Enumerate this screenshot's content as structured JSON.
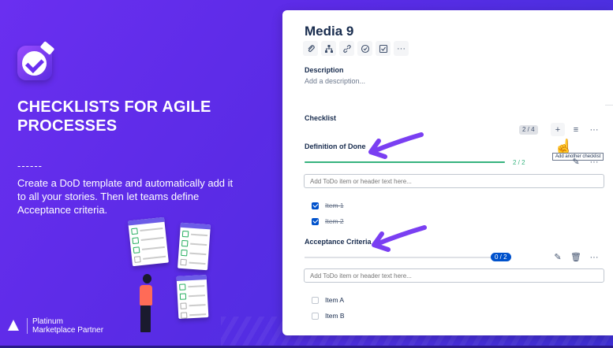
{
  "marketing": {
    "headline": "CHECKLISTS FOR AGILE PROCESSES",
    "dashes": "------",
    "blurb": "Create a DoD template and automatically add it to all your stories. Then let teams define Acceptance criteria.",
    "partner_line1": "Platinum",
    "partner_line2": "Marketplace Partner",
    "partner_logo_text": "ATLASSIAN"
  },
  "issue": {
    "title": "Media 9",
    "toolbar": [
      {
        "icon": "paperclip-icon"
      },
      {
        "icon": "hierarchy-icon"
      },
      {
        "icon": "link-icon"
      },
      {
        "icon": "clock-icon"
      },
      {
        "icon": "checklist-icon"
      },
      {
        "icon": "more-icon",
        "glyph": "···"
      }
    ],
    "description_label": "Description",
    "description_placeholder": "Add a description..."
  },
  "checklist": {
    "label": "Checklist",
    "count": "2 / 4",
    "add_glyph": "+",
    "filter_glyph": "≡",
    "more_glyph": "···",
    "tooltip": "Add another checklist",
    "sections": [
      {
        "title": "Definition of Done",
        "progress": 1.0,
        "progress_label": "2 / 2",
        "bar_color": "#36b37e",
        "input_placeholder": "Add ToDo item or header text here...",
        "items": [
          {
            "label": "Item 1",
            "done": true
          },
          {
            "label": "Item 2",
            "done": true
          }
        ]
      },
      {
        "title": "Acceptance Criteria",
        "progress": 0,
        "progress_label": "0 / 2",
        "bar_color": "#0052cc",
        "input_placeholder": "Add ToDo item or header text here...",
        "items": [
          {
            "label": "Item A",
            "done": false
          },
          {
            "label": "Item B",
            "done": false
          }
        ]
      }
    ]
  },
  "colors": {
    "background": "#5b2be6",
    "accent_blue": "#0052cc",
    "success_green": "#36b37e",
    "arrow_purple": "#7a3ff2"
  }
}
